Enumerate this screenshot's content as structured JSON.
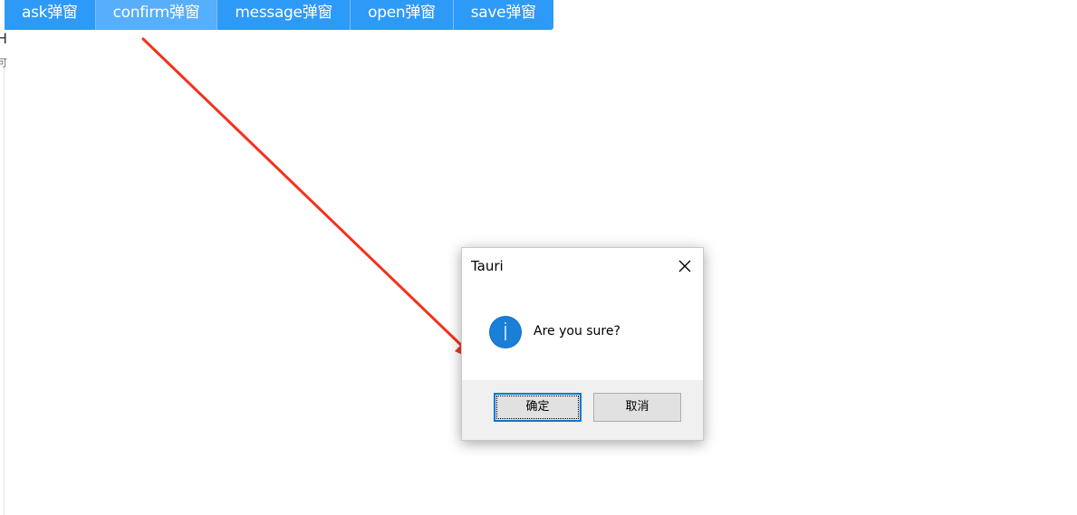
{
  "toolbar": {
    "buttons": [
      {
        "label": "ask弹窗"
      },
      {
        "label": "confirm弹窗"
      },
      {
        "label": "message弹窗"
      },
      {
        "label": "open弹窗"
      },
      {
        "label": "save弹窗"
      }
    ],
    "active_index": 1,
    "color": "#2d9af8",
    "active_color": "#57aefa"
  },
  "dialog": {
    "title": "Tauri",
    "message": "Are you sure?",
    "icon": "info-icon",
    "ok_label": "确定",
    "cancel_label": "取消",
    "accent_color": "#0078d7"
  },
  "annotation": {
    "arrow_color": "#f5311d"
  },
  "left_fragment": {
    "glyph1": "H",
    "glyph2": "可"
  }
}
